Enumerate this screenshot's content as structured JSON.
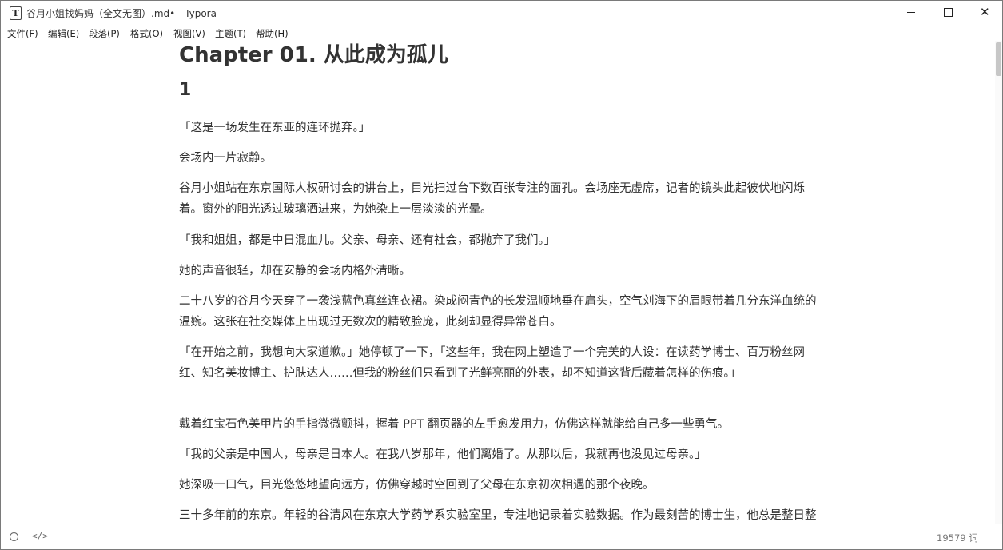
{
  "window": {
    "title": "谷月小姐找妈妈（全文无图）.md• - Typora",
    "app_icon": "T",
    "minimize_icon": "minimize-icon",
    "maximize_icon": "maximize-icon",
    "close_icon": "close-icon"
  },
  "menu": [
    "文件(F)",
    "编辑(E)",
    "段落(P)",
    "格式(O)",
    "视图(V)",
    "主题(T)",
    "帮助(H)"
  ],
  "document": {
    "h1": "Chapter 01. 从此成为孤儿",
    "h2": "1",
    "paragraphs": [
      "「这是一场发生在东亚的连环抛弃。」",
      "会场内一片寂静。",
      "谷月小姐站在东京国际人权研讨会的讲台上，目光扫过台下数百张专注的面孔。会场座无虚席，记者的镜头此起彼伏地闪烁着。窗外的阳光透过玻璃洒进来，为她染上一层淡淡的光晕。",
      "「我和姐姐，都是中日混血儿。父亲、母亲、还有社会，都抛弃了我们。」",
      "她的声音很轻，却在安静的会场内格外清晰。",
      "二十八岁的谷月今天穿了一袭浅蓝色真丝连衣裙。染成闷青色的长发温顺地垂在肩头，空气刘海下的眉眼带着几分东洋血统的温婉。这张在社交媒体上出现过无数次的精致脸庞，此刻却显得异常苍白。",
      "「在开始之前，我想向大家道歉。」她停顿了一下，「这些年，我在网上塑造了一个完美的人设：在读药学博士、百万粉丝网红、知名美妆博主、护肤达人……但我的粉丝们只看到了光鲜亮丽的外表，却不知道这背后藏着怎样的伤痕。」",
      "戴着红宝石色美甲片的手指微微颤抖，握着 PPT 翻页器的左手愈发用力，仿佛这样就能给自己多一些勇气。",
      "「我的父亲是中国人，母亲是日本人。在我八岁那年，他们离婚了。从那以后，我就再也没见过母亲。」",
      "她深吸一口气，目光悠悠地望向远方，仿佛穿越时空回到了父母在东京初次相遇的那个夜晚。",
      "三十多年前的东京。年轻的谷清风在东京大学药学系实验室里，专注地记录着实验数据。作为最刻苦的博士生，他总是整日整夜泡在实验室里，每天最早一个来，最后一个离开实验室。"
    ]
  },
  "status": {
    "outline_icon": "circle-icon",
    "source_icon": "code-icon",
    "source_symbol": "</>",
    "word_count": "19579 词"
  }
}
